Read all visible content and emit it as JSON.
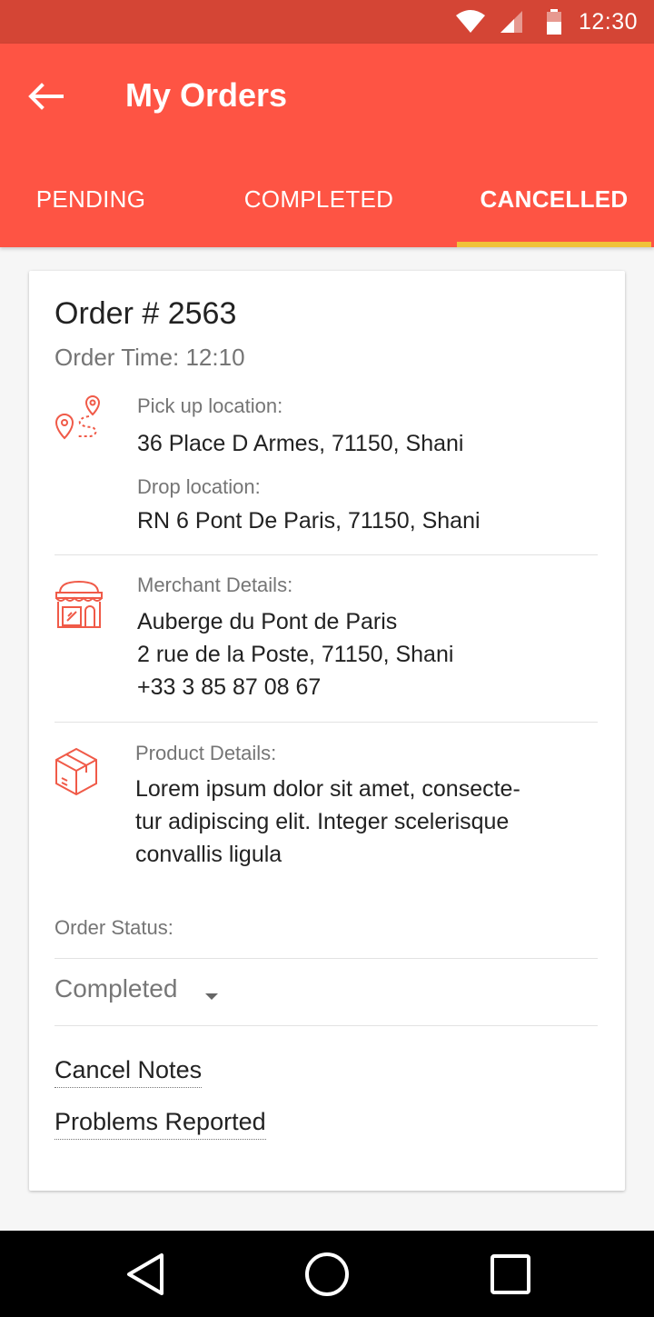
{
  "status_bar": {
    "time": "12:30",
    "icons": [
      "wifi-icon",
      "signal-icon",
      "battery-icon"
    ]
  },
  "header": {
    "title": "My Orders",
    "back_icon": "arrow-left-icon"
  },
  "tabs": [
    {
      "label": "PENDING",
      "active": false
    },
    {
      "label": "COMPLETED",
      "active": false
    },
    {
      "label": "CANCELLED",
      "active": true
    }
  ],
  "colors": {
    "primary": "#fe5444",
    "status_bar": "#d44535",
    "tab_indicator": "#f0c239",
    "icon": "#f05a48"
  },
  "order": {
    "number": "Order # 2563",
    "time": "Order Time: 12:10",
    "pickup_label": "Pick up location:",
    "pickup_value": "36 Place D Armes, 71150, Shani",
    "drop_label": "Drop location:",
    "drop_value": "RN 6 Pont De Paris, 71150, Shani",
    "merchant_label": "Merchant Details:",
    "merchant_name": "Auberge du Pont de Paris",
    "merchant_address": "2 rue de la Poste, 71150, Shani",
    "merchant_phone": "+33 3 85 87 08 67",
    "product_label": "Product Details:",
    "product_lines": [
      "Lorem ipsum dolor sit amet, consecte-",
      "tur adipiscing elit. Integer scelerisque",
      "convallis ligula"
    ],
    "status_label": "Order Status:",
    "status_value": "Completed",
    "cancel_notes": "Cancel Notes",
    "problems_reported": "Problems Reported"
  },
  "nav": [
    "back-triangle-icon",
    "home-circle-icon",
    "recents-square-icon"
  ]
}
